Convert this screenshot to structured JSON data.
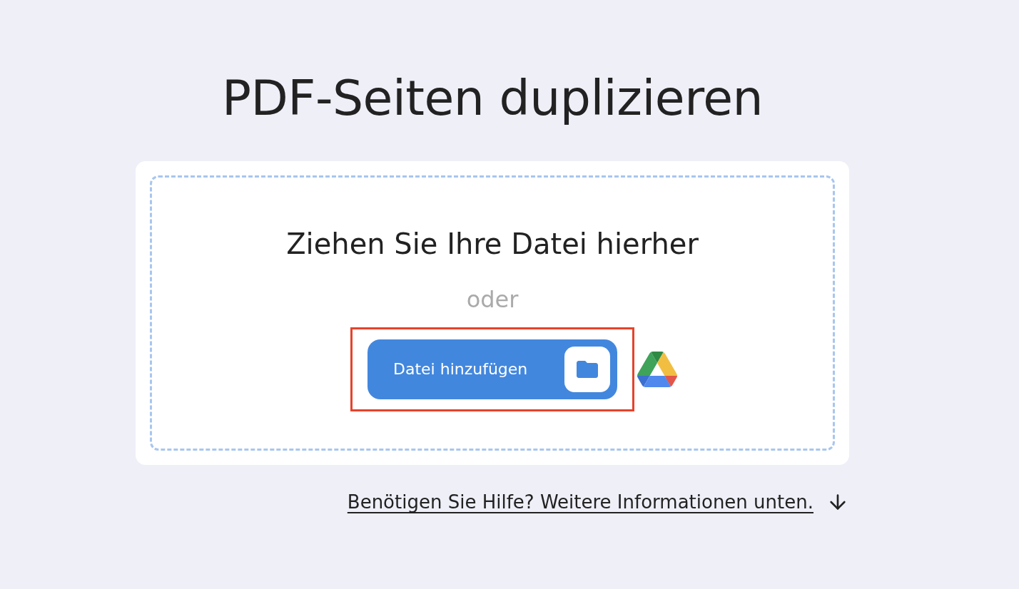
{
  "title": "PDF-Seiten duplizieren",
  "dropzone": {
    "prompt": "Ziehen Sie Ihre Datei hierher",
    "separator": "oder",
    "upload_button": {
      "label": "Datei hinzufügen",
      "highlighted": true
    }
  },
  "help_link": "Benötigen Sie Hilfe? Weitere Informationen unten."
}
